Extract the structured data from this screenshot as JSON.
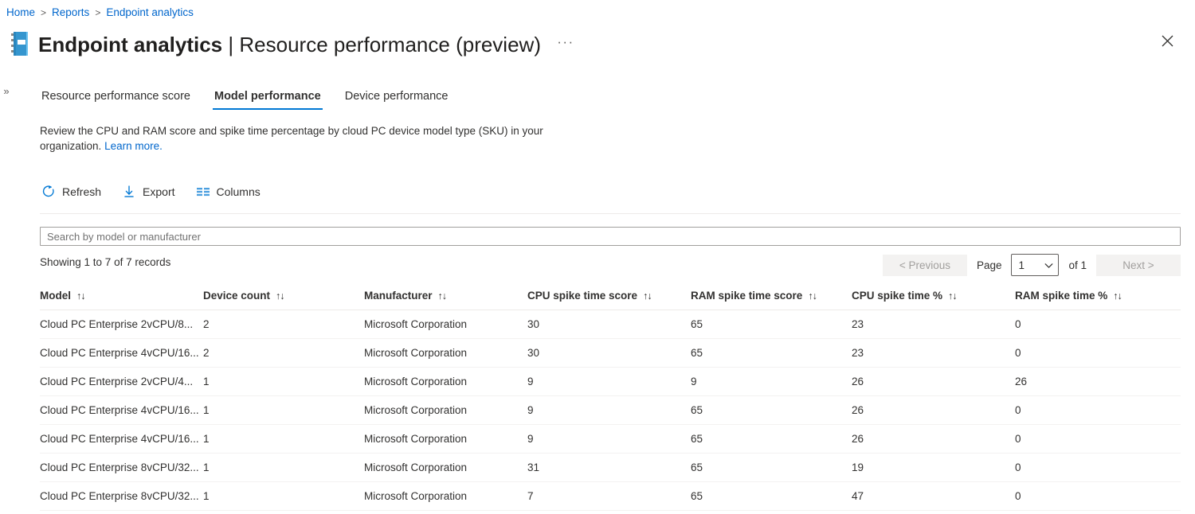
{
  "breadcrumb": {
    "items": [
      {
        "label": "Home"
      },
      {
        "label": "Reports"
      },
      {
        "label": "Endpoint analytics"
      }
    ],
    "separator": ">"
  },
  "header": {
    "icon_name": "report-book-icon",
    "title_main": "Endpoint analytics",
    "title_divider": "|",
    "title_sub": "Resource performance (preview)",
    "more_label": "···",
    "close_label": "✕",
    "expander_label": "»"
  },
  "tabs": [
    {
      "label": "Resource performance score",
      "active": false
    },
    {
      "label": "Model performance",
      "active": true
    },
    {
      "label": "Device performance",
      "active": false
    }
  ],
  "description": {
    "text": "Review the CPU and RAM score and spike time percentage by cloud PC device model type (SKU) in your organization.",
    "link_label": "Learn more."
  },
  "toolbar": {
    "refresh_label": "Refresh",
    "export_label": "Export",
    "columns_label": "Columns"
  },
  "search": {
    "value": "",
    "placeholder": "Search by model or manufacturer"
  },
  "pagination": {
    "records_text": "Showing 1 to 7 of 7 records",
    "previous_label": "< Previous",
    "page_label": "Page",
    "page_value": "1",
    "page_options": [
      "1"
    ],
    "of_label": "of 1",
    "next_label": "Next >"
  },
  "table": {
    "sort_icon": "↑↓",
    "columns": [
      "Model",
      "Device count",
      "Manufacturer",
      "CPU spike time score",
      "RAM spike time score",
      "CPU spike time %",
      "RAM spike time %"
    ],
    "rows": [
      [
        "Cloud PC Enterprise 2vCPU/8...",
        "2",
        "Microsoft Corporation",
        "30",
        "65",
        "23",
        "0"
      ],
      [
        "Cloud PC Enterprise 4vCPU/16...",
        "2",
        "Microsoft Corporation",
        "30",
        "65",
        "23",
        "0"
      ],
      [
        "Cloud PC Enterprise 2vCPU/4...",
        "1",
        "Microsoft Corporation",
        "9",
        "9",
        "26",
        "26"
      ],
      [
        "Cloud PC Enterprise 4vCPU/16...",
        "1",
        "Microsoft Corporation",
        "9",
        "65",
        "26",
        "0"
      ],
      [
        "Cloud PC Enterprise 4vCPU/16...",
        "1",
        "Microsoft Corporation",
        "9",
        "65",
        "26",
        "0"
      ],
      [
        "Cloud PC Enterprise 8vCPU/32...",
        "1",
        "Microsoft Corporation",
        "31",
        "65",
        "19",
        "0"
      ],
      [
        "Cloud PC Enterprise 8vCPU/32...",
        "1",
        "Microsoft Corporation",
        "7",
        "65",
        "47",
        "0"
      ]
    ]
  },
  "colors": {
    "accent": "#0078d4",
    "link": "#0066cc",
    "text": "#323130",
    "border": "#edebe9"
  }
}
